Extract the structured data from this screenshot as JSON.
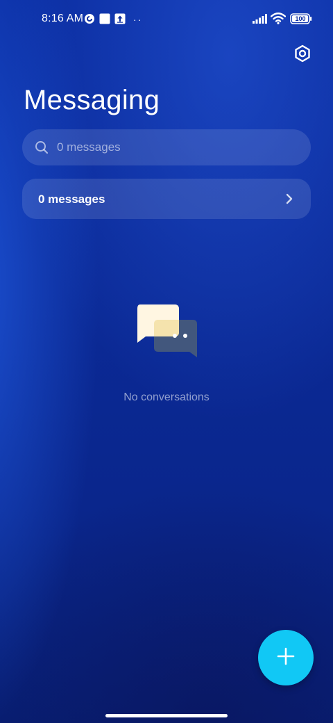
{
  "status_bar": {
    "time": "8:16 AM",
    "battery": "100",
    "left_icons": [
      "hotspot-icon",
      "square-notification-icon",
      "upload-icon",
      "more-dots-icon"
    ],
    "right_icons": [
      "signal-icon",
      "wifi-icon",
      "battery-icon"
    ]
  },
  "header": {
    "title": "Messaging",
    "settings_icon": "settings-hexagon-icon"
  },
  "search": {
    "placeholder": "0 messages",
    "value": ""
  },
  "messages_row": {
    "label": "0 messages"
  },
  "empty_state": {
    "icon": "chat-bubbles-icon",
    "text": "No conversations"
  },
  "fab": {
    "icon": "plus-icon"
  },
  "colors": {
    "accent": "#11c8f5",
    "background_top": "#0a2b9e",
    "background_bottom": "#081e73",
    "bubble_front": "#fff6e2",
    "bubble_back": "#42577d",
    "bubble_overlap": "#f5e3ad"
  }
}
